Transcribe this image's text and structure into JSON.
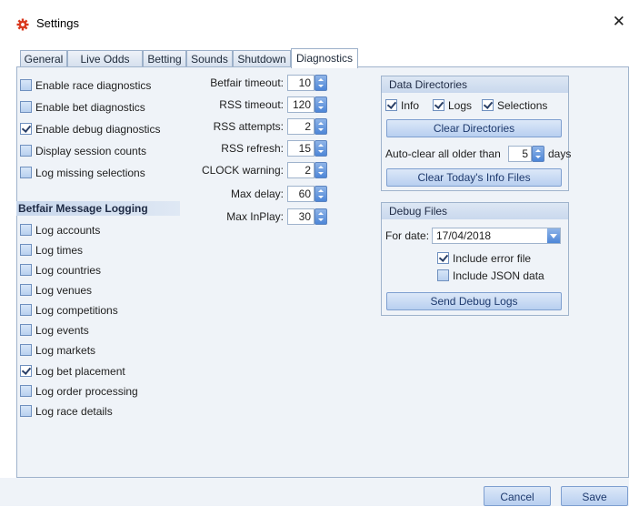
{
  "window": {
    "title": "Settings",
    "close_glyph": "✕"
  },
  "tabs": [
    {
      "label": "General"
    },
    {
      "label": "Live Odds"
    },
    {
      "label": "Betting"
    },
    {
      "label": "Sounds"
    },
    {
      "label": "Shutdown"
    },
    {
      "label": "Diagnostics",
      "active": true
    }
  ],
  "diagnostics": [
    {
      "label": "Enable race diagnostics",
      "checked": false
    },
    {
      "label": "Enable bet diagnostics",
      "checked": false
    },
    {
      "label": "Enable debug diagnostics",
      "checked": true
    },
    {
      "label": "Display session counts",
      "checked": false
    },
    {
      "label": "Log missing selections",
      "checked": false
    }
  ],
  "message_logging": {
    "heading": "Betfair Message Logging",
    "items": [
      {
        "label": "Log accounts",
        "checked": false
      },
      {
        "label": "Log times",
        "checked": false
      },
      {
        "label": "Log countries",
        "checked": false
      },
      {
        "label": "Log venues",
        "checked": false
      },
      {
        "label": "Log competitions",
        "checked": false
      },
      {
        "label": "Log events",
        "checked": false
      },
      {
        "label": "Log markets",
        "checked": false
      },
      {
        "label": "Log bet placement",
        "checked": true
      },
      {
        "label": "Log order processing",
        "checked": false
      },
      {
        "label": "Log race details",
        "checked": false
      }
    ]
  },
  "numeric_settings": [
    {
      "label": "Betfair timeout:",
      "value": "10"
    },
    {
      "label": "RSS timeout:",
      "value": "120"
    },
    {
      "label": "RSS attempts:",
      "value": "2"
    },
    {
      "label": "RSS refresh:",
      "value": "15"
    },
    {
      "label": "CLOCK warning:",
      "value": "2"
    },
    {
      "label": "Max delay:",
      "value": "60"
    },
    {
      "label": "Max InPlay:",
      "value": "30"
    }
  ],
  "data_directories": {
    "title": "Data Directories",
    "info": {
      "label": "Info",
      "checked": true
    },
    "logs": {
      "label": "Logs",
      "checked": true
    },
    "selections": {
      "label": "Selections",
      "checked": true
    },
    "clear_directories_label": "Clear Directories",
    "auto_clear_label": "Auto-clear all older than",
    "auto_clear_value": "5",
    "auto_clear_unit": "days",
    "clear_today_label": "Clear Today's Info Files"
  },
  "debug_files": {
    "title": "Debug Files",
    "date_label": "For date:",
    "date_value": "17/04/2018",
    "include_error": {
      "label": "Include error file",
      "checked": true
    },
    "include_json": {
      "label": "Include JSON data",
      "checked": false
    },
    "send_label": "Send Debug Logs"
  },
  "footer": {
    "cancel_label": "Cancel",
    "save_label": "Save"
  },
  "colors": {
    "accent": "#4d86d8",
    "panel": "#eff3f8",
    "border": "#9fb3cc",
    "app_icon": "#d9381e"
  }
}
